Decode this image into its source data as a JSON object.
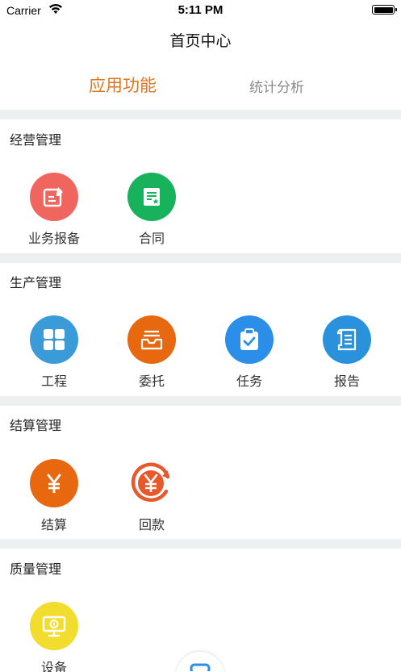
{
  "status_bar": {
    "carrier": "Carrier",
    "time": "5:11 PM"
  },
  "nav": {
    "title": "首页中心"
  },
  "tabs": [
    {
      "label": "应用功能",
      "active": true
    },
    {
      "label": "统计分析",
      "active": false
    }
  ],
  "colors": {
    "accent": "#E2741E",
    "divider": "#EDF0F0",
    "icon_red": "#F0655E",
    "icon_green": "#19B25C",
    "icon_blue": "#3A9BD8",
    "icon_orange": "#E8680F",
    "icon_yellow": "#F2DD2E"
  },
  "sections": [
    {
      "title": "经营管理",
      "items": [
        {
          "label": "业务报备",
          "icon": "report-edit-icon",
          "color": "#F0655E"
        },
        {
          "label": "合同",
          "icon": "contract-icon",
          "color": "#19B25C"
        }
      ]
    },
    {
      "title": "生产管理",
      "items": [
        {
          "label": "工程",
          "icon": "grid-apps-icon",
          "color": "#3A9BD8"
        },
        {
          "label": "委托",
          "icon": "inbox-tray-icon",
          "color": "#E8680F"
        },
        {
          "label": "任务",
          "icon": "clipboard-check-icon",
          "color": "#2B8EE8"
        },
        {
          "label": "报告",
          "icon": "scroll-document-icon",
          "color": "#2A92DC"
        }
      ]
    },
    {
      "title": "结算管理",
      "items": [
        {
          "label": "结算",
          "icon": "yen-icon",
          "color": "#E8680F"
        },
        {
          "label": "回款",
          "icon": "yen-return-icon",
          "color": "#E8582A"
        }
      ]
    },
    {
      "title": "质量管理",
      "items": [
        {
          "label": "设备",
          "icon": "monitor-icon",
          "color": "#F2DD2E"
        }
      ]
    }
  ]
}
